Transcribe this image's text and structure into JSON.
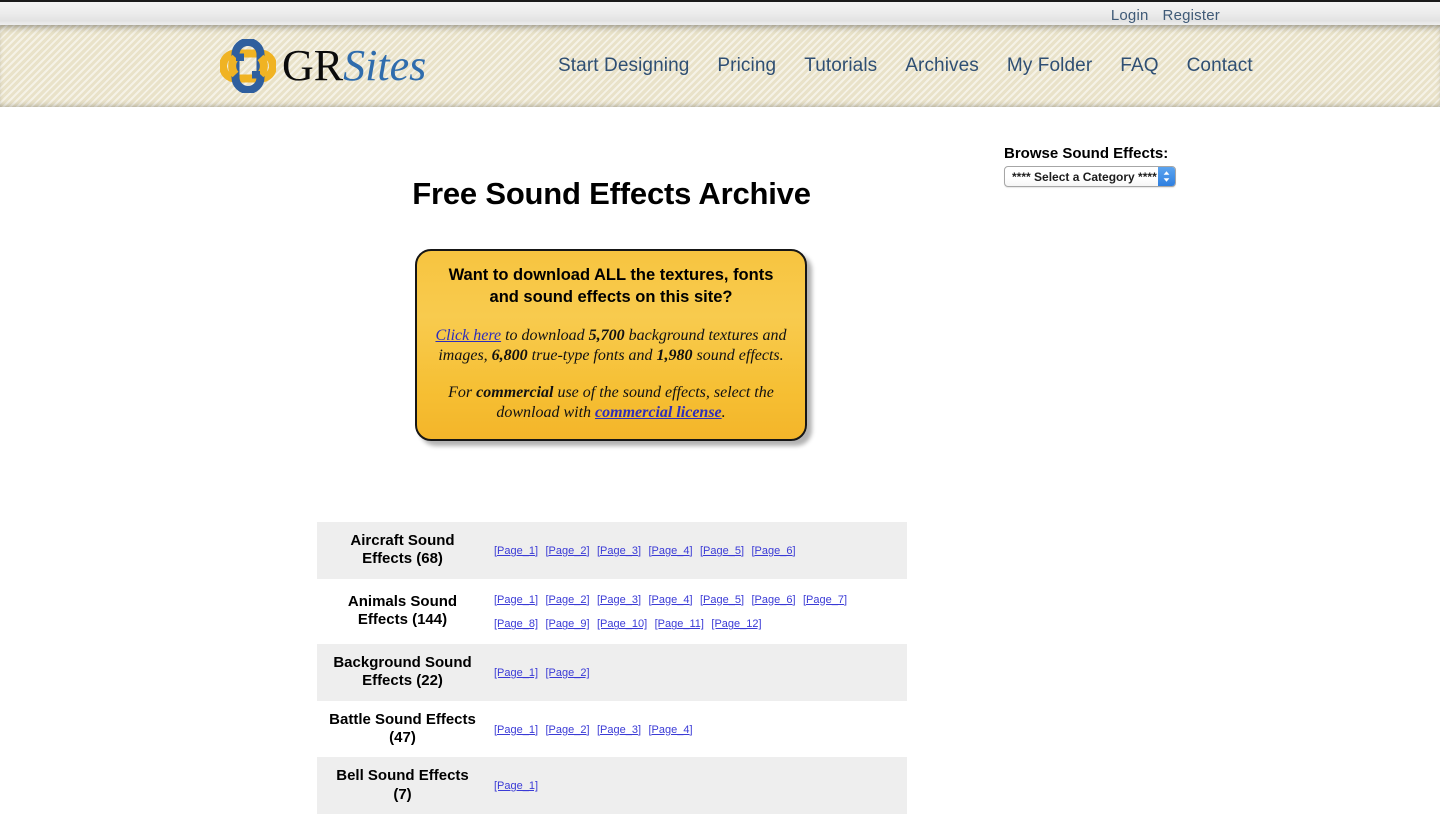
{
  "topbar": {
    "links": [
      {
        "label": "Login",
        "name": "login-link"
      },
      {
        "label": "Register",
        "name": "register-link"
      }
    ]
  },
  "header": {
    "logo": {
      "text_primary": "GR",
      "text_secondary": "Sites",
      "mark_colors": {
        "blue": "#2f5f9e",
        "gold": "#f0b323"
      }
    },
    "nav": [
      {
        "label": "Start Designing",
        "name": "nav-start-designing"
      },
      {
        "label": "Pricing",
        "name": "nav-pricing"
      },
      {
        "label": "Tutorials",
        "name": "nav-tutorials"
      },
      {
        "label": "Archives",
        "name": "nav-archives"
      },
      {
        "label": "My Folder",
        "name": "nav-my-folder"
      },
      {
        "label": "FAQ",
        "name": "nav-faq"
      },
      {
        "label": "Contact",
        "name": "nav-contact"
      }
    ]
  },
  "main": {
    "page_title": "Free Sound Effects Archive",
    "browse": {
      "label": "Browse Sound Effects:",
      "selected_option": "**** Select a Category ****"
    },
    "promo": {
      "heading": "Want to download ALL the textures, fonts and sound effects on this site?",
      "line1_link": "Click here",
      "line1_a": " to download ",
      "line1_count1": "5,700",
      "line1_b": " background textures and images, ",
      "line1_count2": "6,800",
      "line1_c": " true-type fonts and ",
      "line1_count3": "1,980",
      "line1_d": " sound effects.",
      "line2_a": "For ",
      "line2_bold": "commercial",
      "line2_b": " use of the sound effects, select the download with ",
      "line2_link": "commercial license",
      "line2_c": "."
    },
    "categories": [
      {
        "name": "Aircraft Sound Effects (68)",
        "pages": [
          "[Page_1]",
          "[Page_2]",
          "[Page_3]",
          "[Page_4]",
          "[Page_5]",
          "[Page_6]"
        ]
      },
      {
        "name": "Animals Sound Effects (144)",
        "pages": [
          "[Page_1]",
          "[Page_2]",
          "[Page_3]",
          "[Page_4]",
          "[Page_5]",
          "[Page_6]",
          "[Page_7]",
          "[Page_8]",
          "[Page_9]",
          "[Page_10]",
          "[Page_11]",
          "[Page_12]"
        ]
      },
      {
        "name": "Background Sound Effects (22)",
        "pages": [
          "[Page_1]",
          "[Page_2]"
        ]
      },
      {
        "name": "Battle Sound Effects (47)",
        "pages": [
          "[Page_1]",
          "[Page_2]",
          "[Page_3]",
          "[Page_4]"
        ]
      },
      {
        "name": "Bell Sound Effects (7)",
        "pages": [
          "[Page_1]"
        ]
      }
    ]
  },
  "colors": {
    "header_bg": "#e9e2c9",
    "nav_text": "#2f4f73",
    "promo_gold": "#f7c440",
    "link_blue": "#3b3bd6",
    "row_alt": "#eeeeee"
  }
}
